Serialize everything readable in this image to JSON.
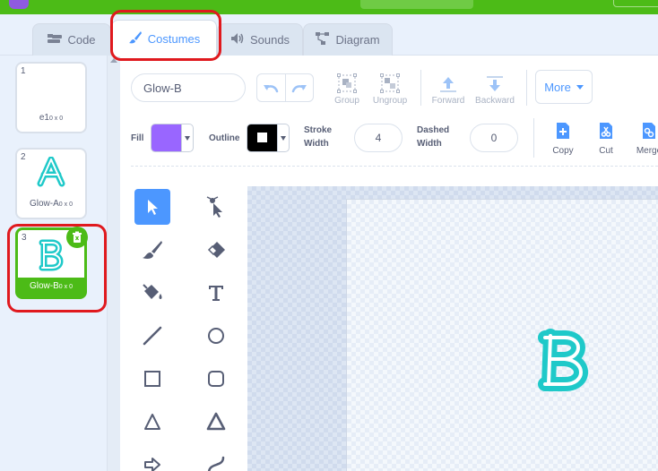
{
  "tabs": [
    {
      "label": "Code",
      "icon": "code-icon"
    },
    {
      "label": "Costumes",
      "icon": "brush-icon"
    },
    {
      "label": "Sounds",
      "icon": "speaker-icon"
    },
    {
      "label": "Diagram",
      "icon": "diagram-icon"
    }
  ],
  "costumes": [
    {
      "number": "1",
      "name": "e1",
      "size": "0 x 0"
    },
    {
      "number": "2",
      "name": "Glow-A",
      "size": "0 x 0"
    },
    {
      "number": "3",
      "name": "Glow-B",
      "size": "0 x 0"
    }
  ],
  "editor": {
    "costume_name": "Glow-B",
    "group": "Group",
    "ungroup": "Ungroup",
    "forward": "Forward",
    "backward": "Backward",
    "more": "More",
    "fill_label": "Fill",
    "outline_label": "Outline",
    "stroke_width_label_1": "Stroke",
    "stroke_width_label_2": "Width",
    "stroke_width_value": "4",
    "dashed_width_label_1": "Dashed",
    "dashed_width_label_2": "Width",
    "dashed_width_value": "0",
    "copy": "Copy",
    "cut": "Cut",
    "merge": "Merge"
  },
  "colors": {
    "fill": "#9966ff",
    "outline": "#000000",
    "accent": "#4c97ff",
    "selected_costume": "#4cbb17",
    "highlight": "#e0191e",
    "glyph": "#1fc9c9"
  },
  "tools": [
    "select-tool",
    "reshape-tool",
    "brush-tool",
    "eraser-tool",
    "fill-tool",
    "text-tool",
    "line-tool",
    "circle-tool",
    "rectangle-tool",
    "rounded-rectangle-tool",
    "triangle-tool",
    "filled-triangle-tool",
    "arrow-tool",
    "curve-tool"
  ]
}
